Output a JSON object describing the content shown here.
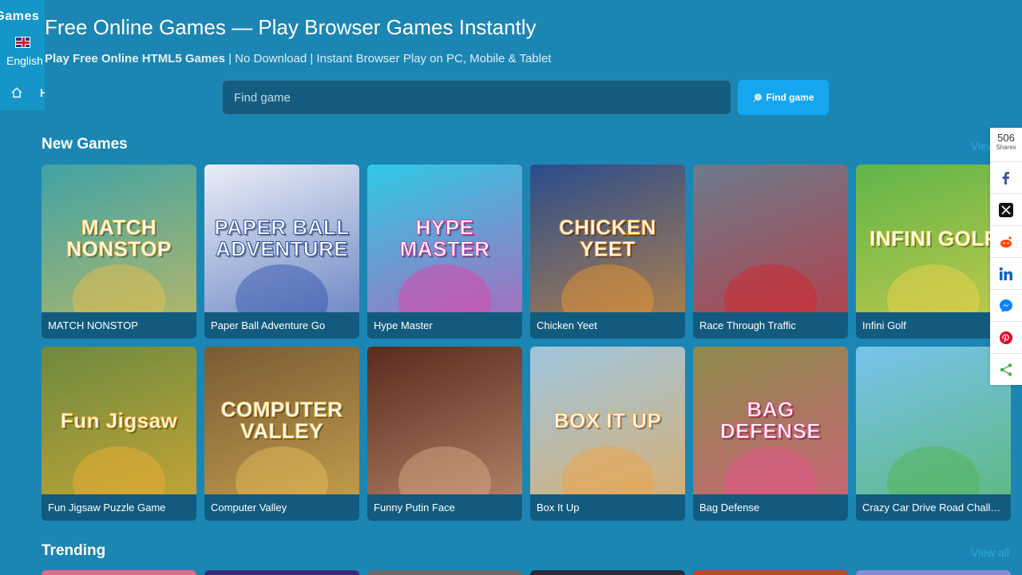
{
  "sidebar": {
    "brand": "yGames",
    "language": "English",
    "home_label": "H"
  },
  "header": {
    "title": "Free Online Games — Play Browser Games Instantly",
    "subtitle_bold": "Play Free Online HTML5 Games",
    "subtitle_rest": " | No Download | Instant Browser Play on PC, Mobile & Tablet"
  },
  "search": {
    "placeholder": "Find game",
    "value": "",
    "button_label": "Find game",
    "button_icon": "magnifier-icon"
  },
  "sections": {
    "new_games": {
      "title": "New Games",
      "view_all": "View all"
    },
    "trending": {
      "title": "Trending",
      "view_all": "View all"
    }
  },
  "games": [
    {
      "title": "MATCH NONSTOP",
      "thumb_text": "MATCH NONSTOP",
      "bg": "#3fa3a6",
      "accent": "#f0c04a"
    },
    {
      "title": "Paper Ball Adventure Go",
      "thumb_text": "PAPER BALL ADVENTURE",
      "bg": "#e9eef7",
      "accent": "#2b4ea8"
    },
    {
      "title": "Hype Master",
      "thumb_text": "HYPE MASTER",
      "bg": "#2ec9e6",
      "accent": "#e83ca8"
    },
    {
      "title": "Chicken Yeet",
      "thumb_text": "CHICKEN YEET",
      "bg": "#2a4c8c",
      "accent": "#f29a2c"
    },
    {
      "title": "Race Through Traffic",
      "thumb_text": "",
      "bg": "#6b7b8c",
      "accent": "#d8232a"
    },
    {
      "title": "Infini Golf",
      "thumb_text": "INFINI GOLF",
      "bg": "#5fb54a",
      "accent": "#f3d34c"
    },
    {
      "title": "Fun Jigsaw Puzzle Game",
      "thumb_text": "Fun Jigsaw",
      "bg": "#6d8a3e",
      "accent": "#f2b233"
    },
    {
      "title": "Computer Valley",
      "thumb_text": "COMPUTER VALLEY",
      "bg": "#7a5a34",
      "accent": "#e8c15a"
    },
    {
      "title": "Funny Putin Face",
      "thumb_text": "",
      "bg": "#5a2a1e",
      "accent": "#e0b08c"
    },
    {
      "title": "Box It Up",
      "thumb_text": "BOX IT UP",
      "bg": "#9fc6df",
      "accent": "#f3a23b"
    },
    {
      "title": "Bag Defense",
      "thumb_text": "BAG DEFENSE",
      "bg": "#8c8a4a",
      "accent": "#e94f8c"
    },
    {
      "title": "Crazy Car Drive Road Challenge",
      "thumb_text": "",
      "bg": "#77c3ec",
      "accent": "#4fb34a"
    }
  ],
  "share": {
    "count": "506",
    "label": "Shares",
    "networks": [
      "facebook-icon",
      "x-icon",
      "reddit-icon",
      "linkedin-icon",
      "messenger-icon",
      "pinterest-icon",
      "share-icon"
    ]
  },
  "trending_colors": [
    "#e96a8a",
    "#3b2a7a",
    "#6a6a6a",
    "#2a2a3a",
    "#c2452a",
    "#8a8ad6"
  ]
}
